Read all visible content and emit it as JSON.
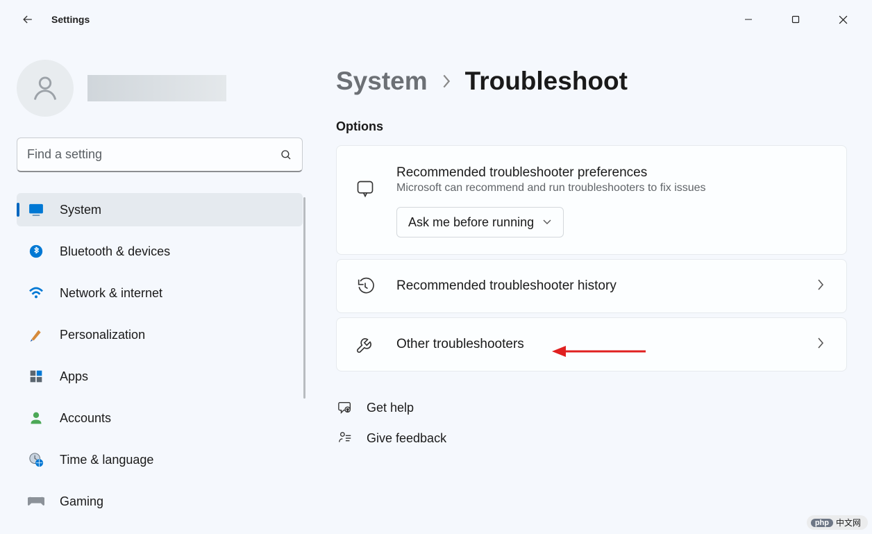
{
  "app": {
    "title": "Settings"
  },
  "search": {
    "placeholder": "Find a setting"
  },
  "sidebar": {
    "items": [
      {
        "label": "System"
      },
      {
        "label": "Bluetooth & devices"
      },
      {
        "label": "Network & internet"
      },
      {
        "label": "Personalization"
      },
      {
        "label": "Apps"
      },
      {
        "label": "Accounts"
      },
      {
        "label": "Time & language"
      },
      {
        "label": "Gaming"
      }
    ]
  },
  "breadcrumb": {
    "parent": "System",
    "current": "Troubleshoot"
  },
  "main": {
    "section_title": "Options",
    "pref": {
      "title": "Recommended troubleshooter preferences",
      "sub": "Microsoft can recommend and run troubleshooters to fix issues",
      "selected": "Ask me before running"
    },
    "history": {
      "title": "Recommended troubleshooter history"
    },
    "other": {
      "title": "Other troubleshooters"
    }
  },
  "footer": {
    "help": "Get help",
    "feedback": "Give feedback"
  },
  "watermark": {
    "brand": "php",
    "text": "中文网"
  }
}
